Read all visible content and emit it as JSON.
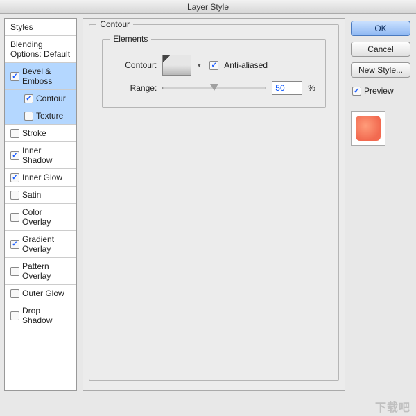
{
  "window": {
    "title": "Layer Style"
  },
  "sidebar": {
    "styles_label": "Styles",
    "blending_label": "Blending Options: Default",
    "items": [
      {
        "label": "Bevel & Emboss",
        "checked": true,
        "selected": true,
        "sub": false
      },
      {
        "label": "Contour",
        "checked": true,
        "selected": true,
        "sub": true
      },
      {
        "label": "Texture",
        "checked": false,
        "selected": true,
        "sub": true
      },
      {
        "label": "Stroke",
        "checked": false,
        "selected": false,
        "sub": false
      },
      {
        "label": "Inner Shadow",
        "checked": true,
        "selected": false,
        "sub": false
      },
      {
        "label": "Inner Glow",
        "checked": true,
        "selected": false,
        "sub": false
      },
      {
        "label": "Satin",
        "checked": false,
        "selected": false,
        "sub": false
      },
      {
        "label": "Color Overlay",
        "checked": false,
        "selected": false,
        "sub": false
      },
      {
        "label": "Gradient Overlay",
        "checked": true,
        "selected": false,
        "sub": false
      },
      {
        "label": "Pattern Overlay",
        "checked": false,
        "selected": false,
        "sub": false
      },
      {
        "label": "Outer Glow",
        "checked": false,
        "selected": false,
        "sub": false
      },
      {
        "label": "Drop Shadow",
        "checked": false,
        "selected": false,
        "sub": false
      }
    ]
  },
  "main": {
    "section_title": "Contour",
    "elements_title": "Elements",
    "contour_label": "Contour:",
    "antialias_label": "Anti-aliased",
    "antialias_checked": true,
    "range_label": "Range:",
    "range_value": "50",
    "range_unit": "%"
  },
  "right": {
    "ok": "OK",
    "cancel": "Cancel",
    "new_style": "New Style...",
    "preview_label": "Preview",
    "preview_checked": true
  },
  "watermark": "下载吧"
}
